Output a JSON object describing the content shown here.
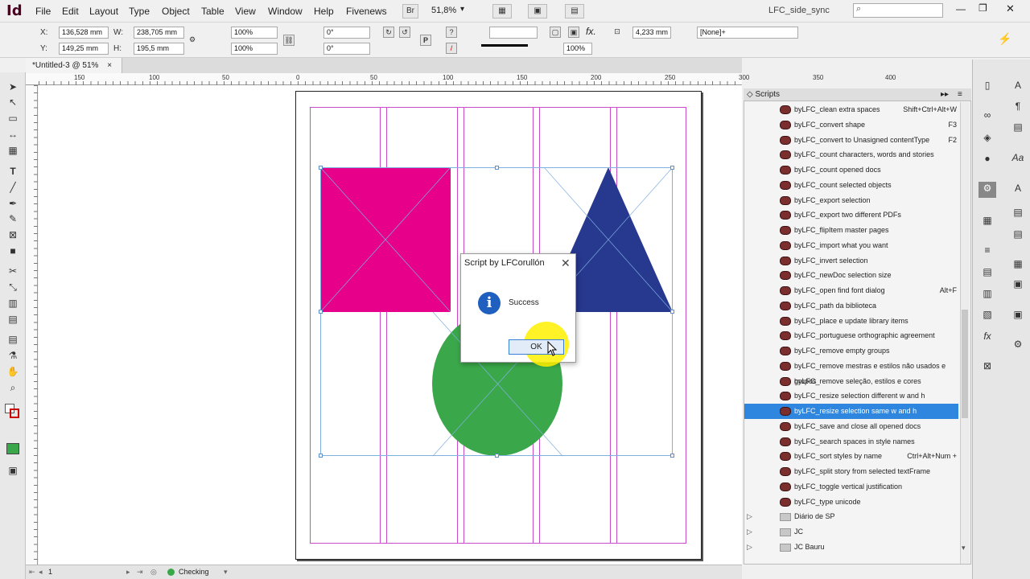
{
  "app": {
    "logo": "Id"
  },
  "menu": [
    "File",
    "Edit",
    "Layout",
    "Type",
    "Object",
    "Table",
    "View",
    "Window",
    "Help",
    "Fivenews"
  ],
  "menubar_right": {
    "bridge": "Br",
    "zoom": "51,8%",
    "workspace": "LFC_side_sync",
    "search_placeholder": ""
  },
  "control": {
    "x_label": "X:",
    "x_value": "136,528 mm",
    "y_label": "Y:",
    "y_value": "149,25 mm",
    "w_label": "W:",
    "w_value": "238,705 mm",
    "h_label": "H:",
    "h_value": "195,5 mm",
    "scale_x": "100%",
    "scale_y": "100%",
    "rotate": "0°",
    "shear": "0°",
    "stroke_weight": "",
    "opacity": "100%",
    "dimension": "4,233 mm",
    "object_style": "[None]+"
  },
  "doc_tab": {
    "label": "*Untitled-3 @ 51%",
    "close": "×"
  },
  "ruler_h": [
    "150",
    "100",
    "50",
    "0",
    "50",
    "100",
    "150",
    "200",
    "250",
    "300",
    "350",
    "400"
  ],
  "status": {
    "page": "1",
    "preflight": "Checking"
  },
  "dialog": {
    "title": "Script by LFCorullón",
    "close": "✕",
    "icon": "i",
    "message": "Success",
    "ok": "OK"
  },
  "scripts_panel": {
    "title": "Scripts",
    "items": [
      {
        "name": "byLFC_clean extra spaces",
        "shortcut": "Shift+Ctrl+Alt+W"
      },
      {
        "name": "byLFC_convert shape",
        "shortcut": "F3"
      },
      {
        "name": "byLFC_convert to Unasigned contentType",
        "shortcut": "F2"
      },
      {
        "name": "byLFC_count characters, words and stories",
        "shortcut": ""
      },
      {
        "name": "byLFC_count opened docs",
        "shortcut": ""
      },
      {
        "name": "byLFC_count selected objects",
        "shortcut": ""
      },
      {
        "name": "byLFC_export selection",
        "shortcut": ""
      },
      {
        "name": "byLFC_export two different PDFs",
        "shortcut": ""
      },
      {
        "name": "byLFC_flipItem master pages",
        "shortcut": ""
      },
      {
        "name": "byLFC_import what you want",
        "shortcut": ""
      },
      {
        "name": "byLFC_invert selection",
        "shortcut": ""
      },
      {
        "name": "byLFC_newDoc selection size",
        "shortcut": ""
      },
      {
        "name": "byLFC_open find font dialog",
        "shortcut": "Alt+F"
      },
      {
        "name": "byLFC_path da biblioteca",
        "shortcut": ""
      },
      {
        "name": "byLFC_place e update library items",
        "shortcut": ""
      },
      {
        "name": "byLFC_portuguese orthographic agreement",
        "shortcut": ""
      },
      {
        "name": "byLFC_remove empty groups",
        "shortcut": ""
      },
      {
        "name": "byLFC_remove mestras e estilos não usados e grupos",
        "shortcut": ""
      },
      {
        "name": "byLFC_remove seleção, estilos e cores",
        "shortcut": ""
      },
      {
        "name": "byLFC_resize selection different w and h",
        "shortcut": ""
      },
      {
        "name": "byLFC_resize selection same w and h",
        "shortcut": "",
        "selected": true
      },
      {
        "name": "byLFC_save and close all opened docs",
        "shortcut": ""
      },
      {
        "name": "byLFC_search spaces in style names",
        "shortcut": ""
      },
      {
        "name": "byLFC_sort styles by name",
        "shortcut": "Ctrl+Alt+Num +"
      },
      {
        "name": "byLFC_split story from selected textFrame",
        "shortcut": ""
      },
      {
        "name": "byLFC_toggle vertical justification",
        "shortcut": ""
      },
      {
        "name": "byLFC_type unicode",
        "shortcut": ""
      }
    ],
    "folders": [
      "Diário de SP",
      "JC",
      "JC Bauru"
    ]
  },
  "colors": {
    "rect": "#e7008a",
    "triangle": "#27388f",
    "circle": "#3aa84a",
    "margin": "#c94cc9",
    "selection": "#2e86de"
  },
  "icons": [
    "selection-tool-icon",
    "direct-selection-tool-icon",
    "page-tool-icon",
    "gap-tool-icon",
    "content-collector-icon",
    "type-tool-icon",
    "line-tool-icon",
    "pen-tool-icon",
    "pencil-tool-icon",
    "rectangle-frame-tool-icon",
    "rectangle-tool-icon",
    "scissors-tool-icon",
    "free-transform-tool-icon",
    "gradient-swatch-tool-icon",
    "gradient-feather-tool-icon",
    "note-tool-icon",
    "eyedropper-tool-icon",
    "hand-tool-icon",
    "zoom-tool-icon"
  ]
}
